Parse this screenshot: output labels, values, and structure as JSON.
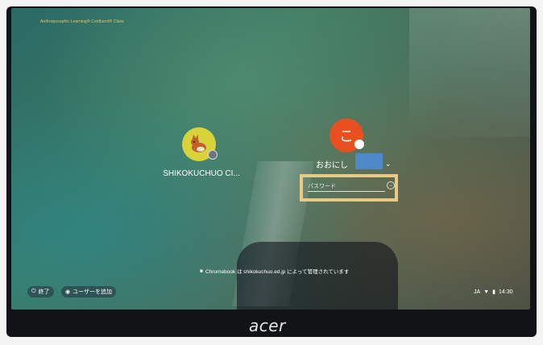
{
  "top_left_label": "Anthroposophic Learning® Confluent® Class",
  "users": [
    {
      "name": "SHIKOKUCHUO CI...",
      "avatar_icon": "dog-icon",
      "badge_icon": "managed-badge-icon"
    },
    {
      "name": "おおにし",
      "avatar_initial": "こ"
    }
  ],
  "password": {
    "placeholder": "パスワード",
    "submit_icon": "arrow-right-icon"
  },
  "managed_notice": "Chromebook は shikokuchuo.ed.jp によって管理されています",
  "shelf": {
    "shutdown_label": "終了",
    "add_user_label": "ユーザーを追加"
  },
  "tray": {
    "lang": "JA",
    "time": "14:30"
  },
  "device_brand": "acer",
  "colors": {
    "highlight": "#e9c986",
    "avatar1": "#d9d33a",
    "avatar2": "#e8501f",
    "redaction": "#4e88c9"
  }
}
